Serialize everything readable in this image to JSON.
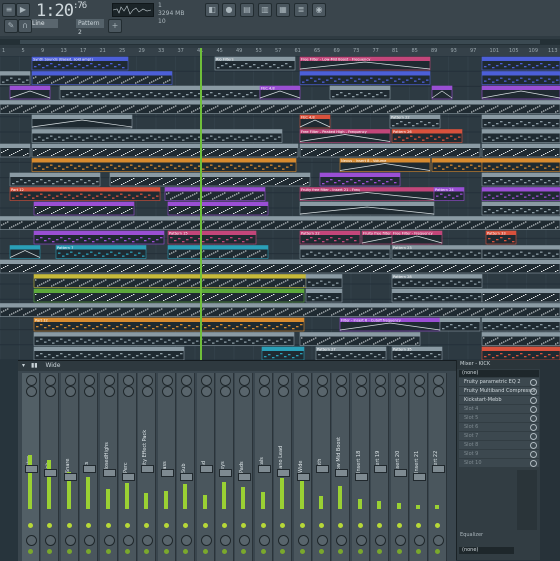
{
  "transport": {
    "time_main": "1:20",
    "time_sub": ":76",
    "line_label": "Line",
    "pattern_label": "Pattern 2",
    "cpu_a": "1",
    "cpu_b": "3294 MB",
    "cpu_c": "10"
  },
  "ruler": {
    "bars": [
      "1",
      "5",
      "9",
      "13",
      "17",
      "21",
      "25",
      "29",
      "33",
      "37",
      "41",
      "45",
      "49",
      "53",
      "57",
      "61",
      "65",
      "69",
      "73",
      "77",
      "81",
      "85",
      "89",
      "93",
      "97",
      "101",
      "105",
      "109",
      "113"
    ]
  },
  "playlist": {
    "labels": {
      "synth_sounds": "Synth Sounds (Based, sold amp!)",
      "rio_filters": "Rio Filters",
      "free_filter_1": "Free Filter - Low-Mid Boost - Frequency",
      "free_filter_2": "Free Filter - Peaked High - Frequency",
      "nexus": "Nexus - Insert 8 - Volume",
      "fruity_free_filter": "Fruity free filter - Insert 21 - Freq",
      "fruity_free_filter_2": "Fruity free filter - Insert 22 - Freq",
      "free_filter_3": "Free Filter - Frequency",
      "filter_cutoff": "Filter - Insert 6 - Cutoff frequency",
      "fx_fec": "FEC 4,8",
      "fx_fec2": "FEC 4,8",
      "ptn_20": "Pattern 20",
      "ptn_21": "Pattern 21",
      "ptn_22": "Pattern 22",
      "ptn_23": "Pattern 23",
      "ptn_24": "Pattern 24",
      "ptn_25": "Pattern 25",
      "ptn_26": "Pattern 26",
      "ptn_27": "Pattern 27",
      "ptn_28": "Pattern 28",
      "ptn_15": "Pattern 15",
      "ptn_7": "Pattern 7",
      "ptn_33": "Pattern 33",
      "ptn_35": "Pattern 35",
      "ptn_54": "Pattern 54",
      "part_12": "Part 12",
      "part_32": "Part 32"
    }
  },
  "mixer": {
    "title": "Wide",
    "strips": [
      "Master",
      "Kick",
      "Snare",
      "Hats",
      "ClosedHighs",
      "Perc",
      "Fruity Effect Pack",
      "Bass",
      "Sub",
      "Lead",
      "Keys",
      "Pads",
      "Vocals",
      "Piano Lead",
      "Wide",
      "Synth",
      "Low Mid Boost",
      "Insert 18",
      "Insert 19",
      "Insert 20",
      "Insert 21",
      "Insert 22"
    ]
  },
  "channel_panel": {
    "title": "Mixer - KICK",
    "input": "(none)",
    "slots": [
      "Fruity parametric EQ 2",
      "Fruity Multiband Compressor",
      "Kickstart-Mebb",
      "Slot 4",
      "Slot 5",
      "Slot 6",
      "Slot 7",
      "Slot 8",
      "Slot 9",
      "Slot 10"
    ],
    "equalizer": "Equalizer",
    "output": "(none)"
  },
  "colors": {
    "blue_clip": "#4c5fd8",
    "purple_clip": "#9a4fd4",
    "red_clip": "#d8513c",
    "pink_clip": "#c3467a",
    "orange_clip": "#d78a2f",
    "green_clip": "#5ca83a",
    "teal_clip": "#2a9fb7",
    "yellow_clip": "#c7b93a",
    "gray_clip": "#8a9aa3",
    "playhead": "#6fbf3a",
    "meter": "#9ad133"
  }
}
